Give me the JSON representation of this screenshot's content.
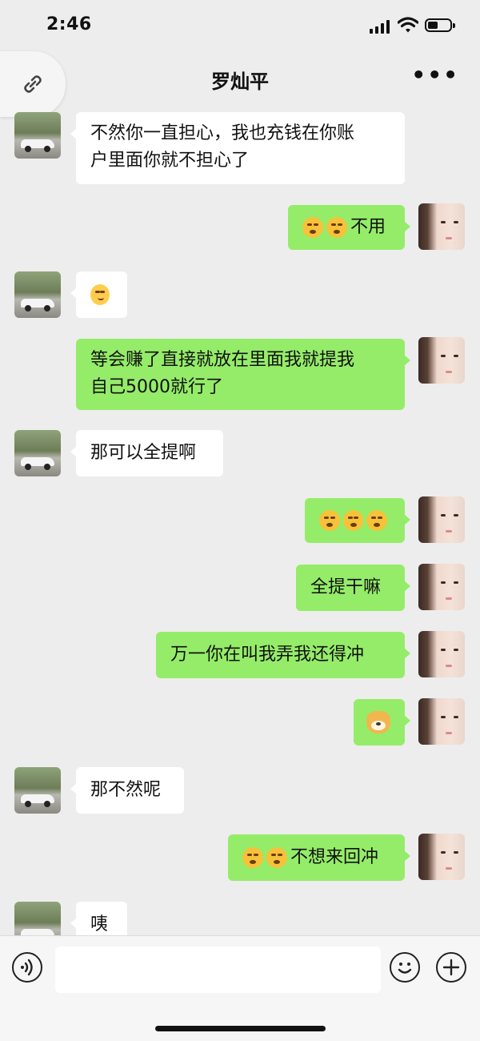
{
  "status_bar": {
    "time": "2:46"
  },
  "header": {
    "title": "罗灿平",
    "more_label": "•••"
  },
  "messages": [
    {
      "side": "in",
      "line1": "不然你一直担心，我也充钱在你账",
      "line2": "户里面你就不担心了"
    },
    {
      "side": "out",
      "text": "不用",
      "emoji": [
        "sleepy-face",
        "sleepy-face"
      ]
    },
    {
      "side": "in",
      "emoji": [
        "smiling-face"
      ]
    },
    {
      "side": "out",
      "line1": "等会赚了直接就放在里面我就提我",
      "line2": "自己5000就行了"
    },
    {
      "side": "in",
      "text": "那可以全提啊"
    },
    {
      "side": "out",
      "emoji": [
        "sleepy-face",
        "sleepy-face",
        "sleepy-face"
      ]
    },
    {
      "side": "out",
      "text": "全提干嘛"
    },
    {
      "side": "out",
      "text": "万一你在叫我弄我还得冲"
    },
    {
      "side": "out",
      "emoji": [
        "doge"
      ]
    },
    {
      "side": "in",
      "text": "那不然呢"
    },
    {
      "side": "out",
      "text": "不想来回冲",
      "emoji": [
        "sleepy-face",
        "sleepy-face"
      ]
    },
    {
      "side": "in",
      "text": "咦"
    }
  ],
  "input_bar": {
    "placeholder": ""
  },
  "colors": {
    "background": "#ededed",
    "outgoing_bubble": "#95ec69",
    "incoming_bubble": "#ffffff"
  }
}
